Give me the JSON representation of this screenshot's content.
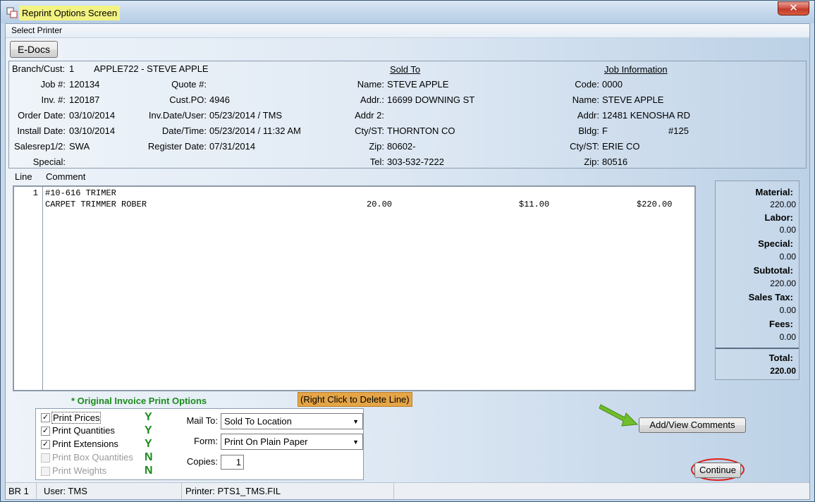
{
  "window": {
    "title": "Reprint Options Screen",
    "close_glyph": "✕"
  },
  "menu": {
    "select_printer": "Select Printer"
  },
  "toolbar": {
    "edocs_label": "E-Docs"
  },
  "header": {
    "branch_cust_label": "Branch/Cust:",
    "branch": "1",
    "customer": "APPLE722 - STEVE APPLE",
    "sold_to_title": "Sold To",
    "job_info_title": "Job Information",
    "job_no_label": "Job #:",
    "job_no": "120134",
    "inv_no_label": "Inv. #:",
    "inv_no": "120187",
    "order_date_label": "Order Date:",
    "order_date": "03/10/2014",
    "install_date_label": "Install Date:",
    "install_date": "03/10/2014",
    "salesrep_label": "Salesrep1/2:",
    "salesrep": "SWA",
    "special_label": "Special:",
    "special": "",
    "quote_label": "Quote #:",
    "quote": "",
    "custpo_label": "Cust.PO:",
    "custpo": "4946",
    "invdate_label": "Inv.Date/User:",
    "invdate": "05/23/2014 / TMS",
    "datetime_label": "Date/Time:",
    "datetime": "05/23/2014 / 11:32 AM",
    "register_label": "Register Date:",
    "register": "07/31/2014",
    "sold_name_label": "Name:",
    "sold_name": "STEVE APPLE",
    "sold_addr_label": "Addr.:",
    "sold_addr": "16699 DOWNING ST",
    "sold_addr2_label": "Addr 2:",
    "sold_addr2": "",
    "sold_cty_label": "Cty/ST:",
    "sold_cty": "THORNTON CO",
    "sold_zip_label": "Zip:",
    "sold_zip": "80602-",
    "sold_tel_label": "Tel:",
    "sold_tel": "303-532-7222",
    "job_code_label": "Code:",
    "job_code": "0000",
    "job_name_label": "Name:",
    "job_name": "STEVE APPLE",
    "job_addr_label": "Addr:",
    "job_addr": "12481 KENOSHA RD",
    "job_bldg_label": "Bldg:",
    "job_bldg": "F",
    "job_unit": "#125",
    "job_cty_label": "Cty/ST:",
    "job_cty": "ERIE CO",
    "job_zip_label": "Zip:",
    "job_zip": "80516"
  },
  "grid": {
    "col_line": "Line",
    "col_comment": "Comment",
    "rows": [
      {
        "line": "1",
        "text": "#10-616 TRIMER"
      },
      {
        "line": "",
        "text": "CARPET TRIMMER ROBER",
        "qty": "20.00",
        "price": "$11.00",
        "ext": "$220.00"
      }
    ]
  },
  "totals": {
    "material_label": "Material:",
    "material": "220.00",
    "labor_label": "Labor:",
    "labor": "0.00",
    "special_label": "Special:",
    "special": "0.00",
    "subtotal_label": "Subtotal:",
    "subtotal": "220.00",
    "tax_label": "Sales Tax:",
    "tax": "0.00",
    "fees_label": "Fees:",
    "fees": "0.00",
    "total_label": "Total:",
    "total": "220.00"
  },
  "options": {
    "title": "* Original Invoice Print Options",
    "delete_note": "(Right Click to Delete Line)",
    "items": [
      {
        "label": "Print Prices",
        "checked": true,
        "enabled": true,
        "flag": "Y"
      },
      {
        "label": "Print Quantities",
        "checked": true,
        "enabled": true,
        "flag": "Y"
      },
      {
        "label": "Print Extensions",
        "checked": true,
        "enabled": true,
        "flag": "Y"
      },
      {
        "label": "Print Box Quantities",
        "checked": false,
        "enabled": false,
        "flag": "N"
      },
      {
        "label": "Print Weights",
        "checked": false,
        "enabled": false,
        "flag": "N"
      }
    ],
    "mail_to_label": "Mail To:",
    "mail_to": "Sold To Location",
    "form_label": "Form:",
    "form": "Print On Plain Paper",
    "copies_label": "Copies:",
    "copies": "1"
  },
  "actions": {
    "add_view_comments": "Add/View Comments",
    "continue": "Continue"
  },
  "status": {
    "branch": "BR 1",
    "user": "User: TMS",
    "printer": "Printer: PTS1_TMS.FIL"
  },
  "colors": {
    "highlight_yellow": "#f3f383",
    "note_orange": "#e5a546",
    "flag_green": "#1b8a1b",
    "annotation_red": "#e0201b",
    "arrow_green": "#6fbe2a"
  }
}
